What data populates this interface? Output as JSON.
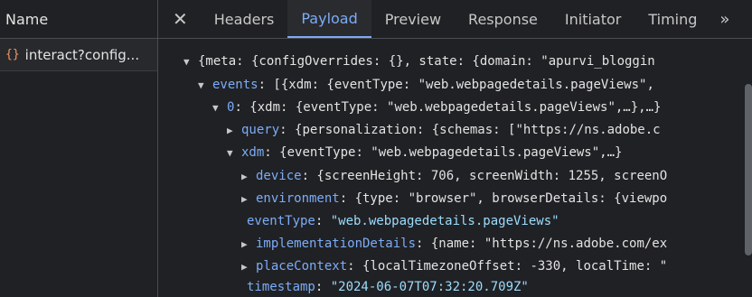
{
  "left_panel": {
    "header": "Name",
    "request": {
      "icon": "json-icon",
      "icon_glyph": "{}",
      "label": "interact?config..."
    }
  },
  "tabs": {
    "close_glyph": "✕",
    "items": [
      "Headers",
      "Payload",
      "Preview",
      "Response",
      "Initiator",
      "Timing"
    ],
    "active": "Payload",
    "more_glyph": "»"
  },
  "tree": [
    {
      "arrow": "▼",
      "key": "",
      "value": "{meta: {configOverrides: {}, state: {domain: \"apurvi_bloggin"
    },
    {
      "arrow": "▼",
      "key": "events",
      "value": ": [{xdm: {eventType: \"web.webpagedetails.pageViews\","
    },
    {
      "arrow": "▼",
      "key": "0",
      "value": ": {xdm: {eventType: \"web.webpagedetails.pageViews\",…},…}"
    },
    {
      "arrow": "▶",
      "key": "query",
      "value": ": {personalization: {schemas: [\"https://ns.adobe.c"
    },
    {
      "arrow": "▼",
      "key": "xdm",
      "value": ": {eventType: \"web.webpagedetails.pageViews\",…}"
    },
    {
      "arrow": "▶",
      "key": "device",
      "value": ": {screenHeight: 706, screenWidth: 1255, screenO"
    },
    {
      "arrow": "▶",
      "key": "environment",
      "value": ": {type: \"browser\", browserDetails: {viewpo"
    },
    {
      "arrow": "",
      "key": "eventType",
      "value": ": ",
      "str": "\"web.webpagedetails.pageViews\""
    },
    {
      "arrow": "▶",
      "key": "implementationDetails",
      "value": ": {name: \"https://ns.adobe.com/ex"
    },
    {
      "arrow": "▶",
      "key": "placeContext",
      "value": ": {localTimezoneOffset: -330, localTime: \""
    },
    {
      "arrow": "",
      "key": "timestamp",
      "value": ": ",
      "str": "\"2024-06-07T07:32:20.709Z\""
    }
  ]
}
